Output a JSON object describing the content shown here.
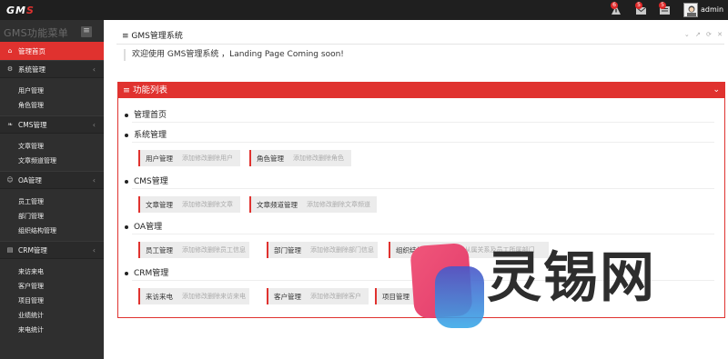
{
  "topbar": {
    "logo": "GMS",
    "notif_count_1": "6",
    "notif_count_2": "5",
    "notif_count_3": "5",
    "admin_name": "admin"
  },
  "sidebar": {
    "title": "GMS功能菜单",
    "toggle": "≡",
    "items": [
      {
        "label": "管理首页"
      },
      {
        "label": "系统管理",
        "children": [
          "用户管理",
          "角色管理"
        ]
      },
      {
        "label": "CMS管理",
        "children": [
          "文章管理",
          "文章频道管理"
        ]
      },
      {
        "label": "OA管理",
        "children": [
          "员工管理",
          "部门管理",
          "组织结构管理"
        ]
      },
      {
        "label": "CRM管理",
        "children": [
          "来访来电",
          "客户管理",
          "项目管理",
          "业绩统计",
          "来电统计"
        ]
      }
    ]
  },
  "main": {
    "header": "≡ GMS管理系统",
    "tools": "⌄ ↗ ⟳ ✕",
    "welcome": "欢迎使用 GMS管理系统 ，Landing Page Coming soon!",
    "func_title": "≡ 功能列表",
    "func_chev": "⌄",
    "sections": [
      {
        "title": "管理首页",
        "cards": []
      },
      {
        "title": "系统管理",
        "cards": [
          {
            "t": "用户管理",
            "d": "添加修改删除用户"
          },
          {
            "t": "角色管理",
            "d": "添加修改删除角色"
          }
        ]
      },
      {
        "title": "CMS管理",
        "cards": [
          {
            "t": "文章管理",
            "d": "添加修改删除文章"
          },
          {
            "t": "文章频道管理",
            "d": "添加修改删除文章频道"
          }
        ]
      },
      {
        "title": "OA管理",
        "cards": [
          {
            "t": "员工管理",
            "d": "添加修改删除员工信息"
          },
          {
            "t": "部门管理",
            "d": "添加修改删除部门信息"
          },
          {
            "t": "组织结构…",
            "d": "管理部门从属关系及员工所属部门"
          }
        ]
      },
      {
        "title": "CRM管理",
        "cards": [
          {
            "t": "来访来电",
            "d": "添加修改删除来访来电"
          },
          {
            "t": "客户管理",
            "d": "添加修改删除客户"
          },
          {
            "t": "项目管理",
            "d": ""
          }
        ]
      }
    ]
  },
  "watermark": {
    "text": "灵锡网"
  },
  "colors": {
    "accent": "#e0322f",
    "topbar": "#1f1f1f",
    "sidebar": "#2f2f2f"
  }
}
